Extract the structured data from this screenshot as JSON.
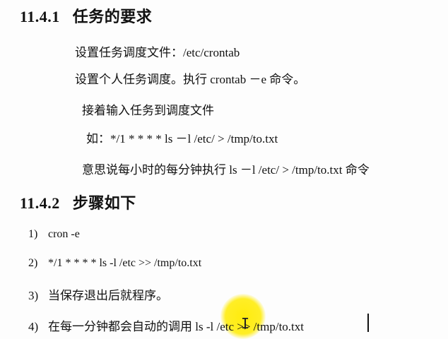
{
  "section1": {
    "number": "11.4.1",
    "title": "任务的要求",
    "lines": {
      "l1": "设置任务调度文件：/etc/crontab",
      "l2": "设置个人任务调度。执行 crontab －e 命令。",
      "l3": "接着输入任务到调度文件",
      "l4": "如：*/1 * * * * ls －l /etc/ > /tmp/to.txt",
      "l5": "意思说每小时的每分钟执行 ls －l /etc/ > /tmp/to.txt 命令"
    }
  },
  "section2": {
    "number": "11.4.2",
    "title": "步骤如下",
    "steps": [
      {
        "num": "1)",
        "text": "cron -e"
      },
      {
        "num": "2)",
        "text": "*/1 * * * * ls -l /etc >> /tmp/to.txt"
      },
      {
        "num": "3)",
        "text": "当保存退出后就程序。"
      },
      {
        "num": "4)",
        "text": "在每一分钟都会自动的调用 ls -l /etc >> /tmp/to.txt"
      }
    ]
  },
  "colors": {
    "highlight": "#ffeb00",
    "text": "#111111"
  }
}
